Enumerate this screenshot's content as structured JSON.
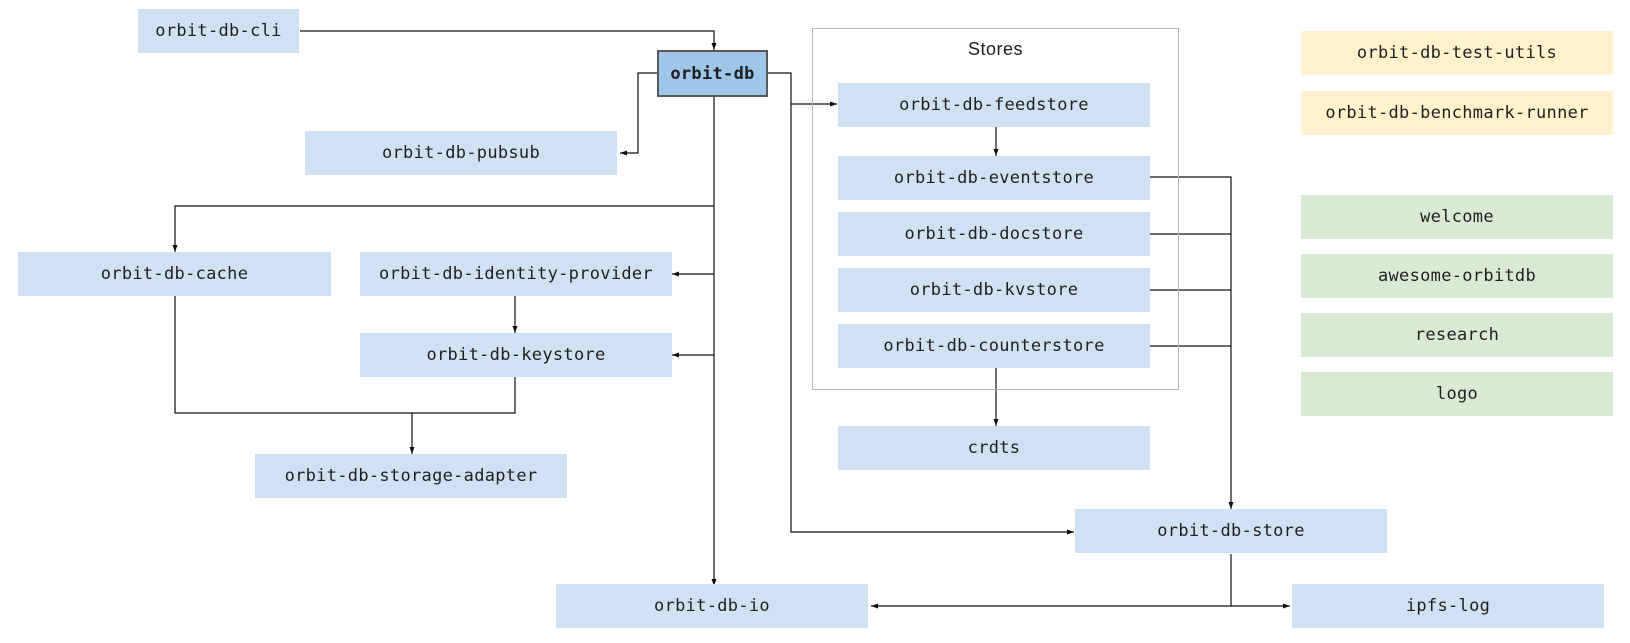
{
  "diagram": {
    "group": {
      "title": "Stores"
    },
    "nodes": {
      "cli": "orbit-db-cli",
      "core": "orbit-db",
      "pubsub": "orbit-db-pubsub",
      "cache": "orbit-db-cache",
      "identity": "orbit-db-identity-provider",
      "keystore": "orbit-db-keystore",
      "storage": "orbit-db-storage-adapter",
      "feedstore": "orbit-db-feedstore",
      "eventstore": "orbit-db-eventstore",
      "docstore": "orbit-db-docstore",
      "kvstore": "orbit-db-kvstore",
      "counterstore": "orbit-db-counterstore",
      "crdts": "crdts",
      "store": "orbit-db-store",
      "io": "orbit-db-io",
      "ipfslog": "ipfs-log",
      "testutils": "orbit-db-test-utils",
      "benchmark": "orbit-db-benchmark-runner",
      "welcome": "welcome",
      "awesome": "awesome-orbitdb",
      "research": "research",
      "logo": "logo"
    },
    "edges": [
      {
        "from": "orbit-db-cli",
        "to": "orbit-db"
      },
      {
        "from": "orbit-db",
        "to": "orbit-db-pubsub"
      },
      {
        "from": "orbit-db",
        "to": "orbit-db-cache"
      },
      {
        "from": "orbit-db",
        "to": "orbit-db-identity-provider"
      },
      {
        "from": "orbit-db",
        "to": "orbit-db-keystore"
      },
      {
        "from": "orbit-db",
        "to": "orbit-db-io"
      },
      {
        "from": "orbit-db",
        "to": "orbit-db-feedstore"
      },
      {
        "from": "orbit-db",
        "to": "orbit-db-store"
      },
      {
        "from": "orbit-db-identity-provider",
        "to": "orbit-db-keystore"
      },
      {
        "from": "orbit-db-cache",
        "to": "orbit-db-storage-adapter"
      },
      {
        "from": "orbit-db-keystore",
        "to": "orbit-db-storage-adapter"
      },
      {
        "from": "orbit-db-feedstore",
        "to": "orbit-db-eventstore"
      },
      {
        "from": "orbit-db-counterstore",
        "to": "crdts"
      },
      {
        "from": "orbit-db-eventstore",
        "to": "orbit-db-store"
      },
      {
        "from": "orbit-db-docstore",
        "to": "orbit-db-store"
      },
      {
        "from": "orbit-db-kvstore",
        "to": "orbit-db-store"
      },
      {
        "from": "orbit-db-counterstore",
        "to": "orbit-db-store"
      },
      {
        "from": "orbit-db-store",
        "to": "orbit-db-io"
      },
      {
        "from": "orbit-db-store",
        "to": "ipfs-log"
      }
    ],
    "colors": {
      "core": "#9fc5e8",
      "module": "#cfe2f3",
      "tooling": "#fff2cc",
      "community": "#d9ead3"
    }
  }
}
